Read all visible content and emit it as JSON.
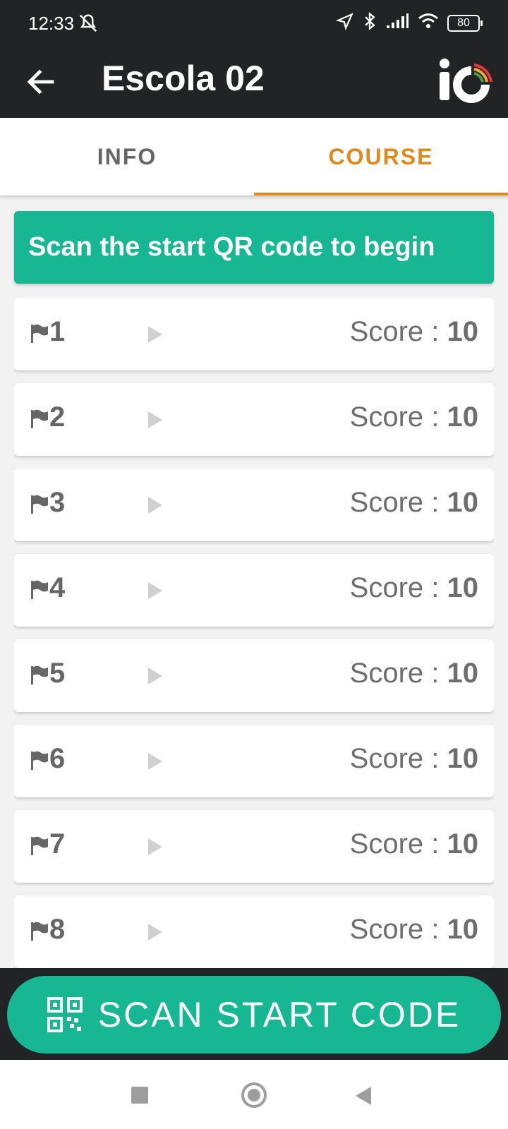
{
  "status_bar": {
    "time": "12:33",
    "battery": "80",
    "icons": [
      "notifications-off-icon",
      "location-arrow-icon",
      "bluetooth-icon",
      "signal-icon",
      "wifi-icon",
      "battery-icon"
    ]
  },
  "app_bar": {
    "title": "Escola 02"
  },
  "tabs": [
    {
      "label": "INFO"
    },
    {
      "label": "COURSE"
    }
  ],
  "banner": {
    "text": "Scan the start QR code to begin"
  },
  "checkpoints": [
    {
      "number": "1",
      "score_label": "Score :",
      "score_value": "10"
    },
    {
      "number": "2",
      "score_label": "Score :",
      "score_value": "10"
    },
    {
      "number": "3",
      "score_label": "Score :",
      "score_value": "10"
    },
    {
      "number": "4",
      "score_label": "Score :",
      "score_value": "10"
    },
    {
      "number": "5",
      "score_label": "Score :",
      "score_value": "10"
    },
    {
      "number": "6",
      "score_label": "Score :",
      "score_value": "10"
    },
    {
      "number": "7",
      "score_label": "Score :",
      "score_value": "10"
    },
    {
      "number": "8",
      "score_label": "Score :",
      "score_value": "10"
    }
  ],
  "scan_button": {
    "label": "SCAN START CODE"
  },
  "colors": {
    "accent_green": "#17b793",
    "accent_orange": "#e08a1e",
    "dark_bar": "#222325"
  }
}
